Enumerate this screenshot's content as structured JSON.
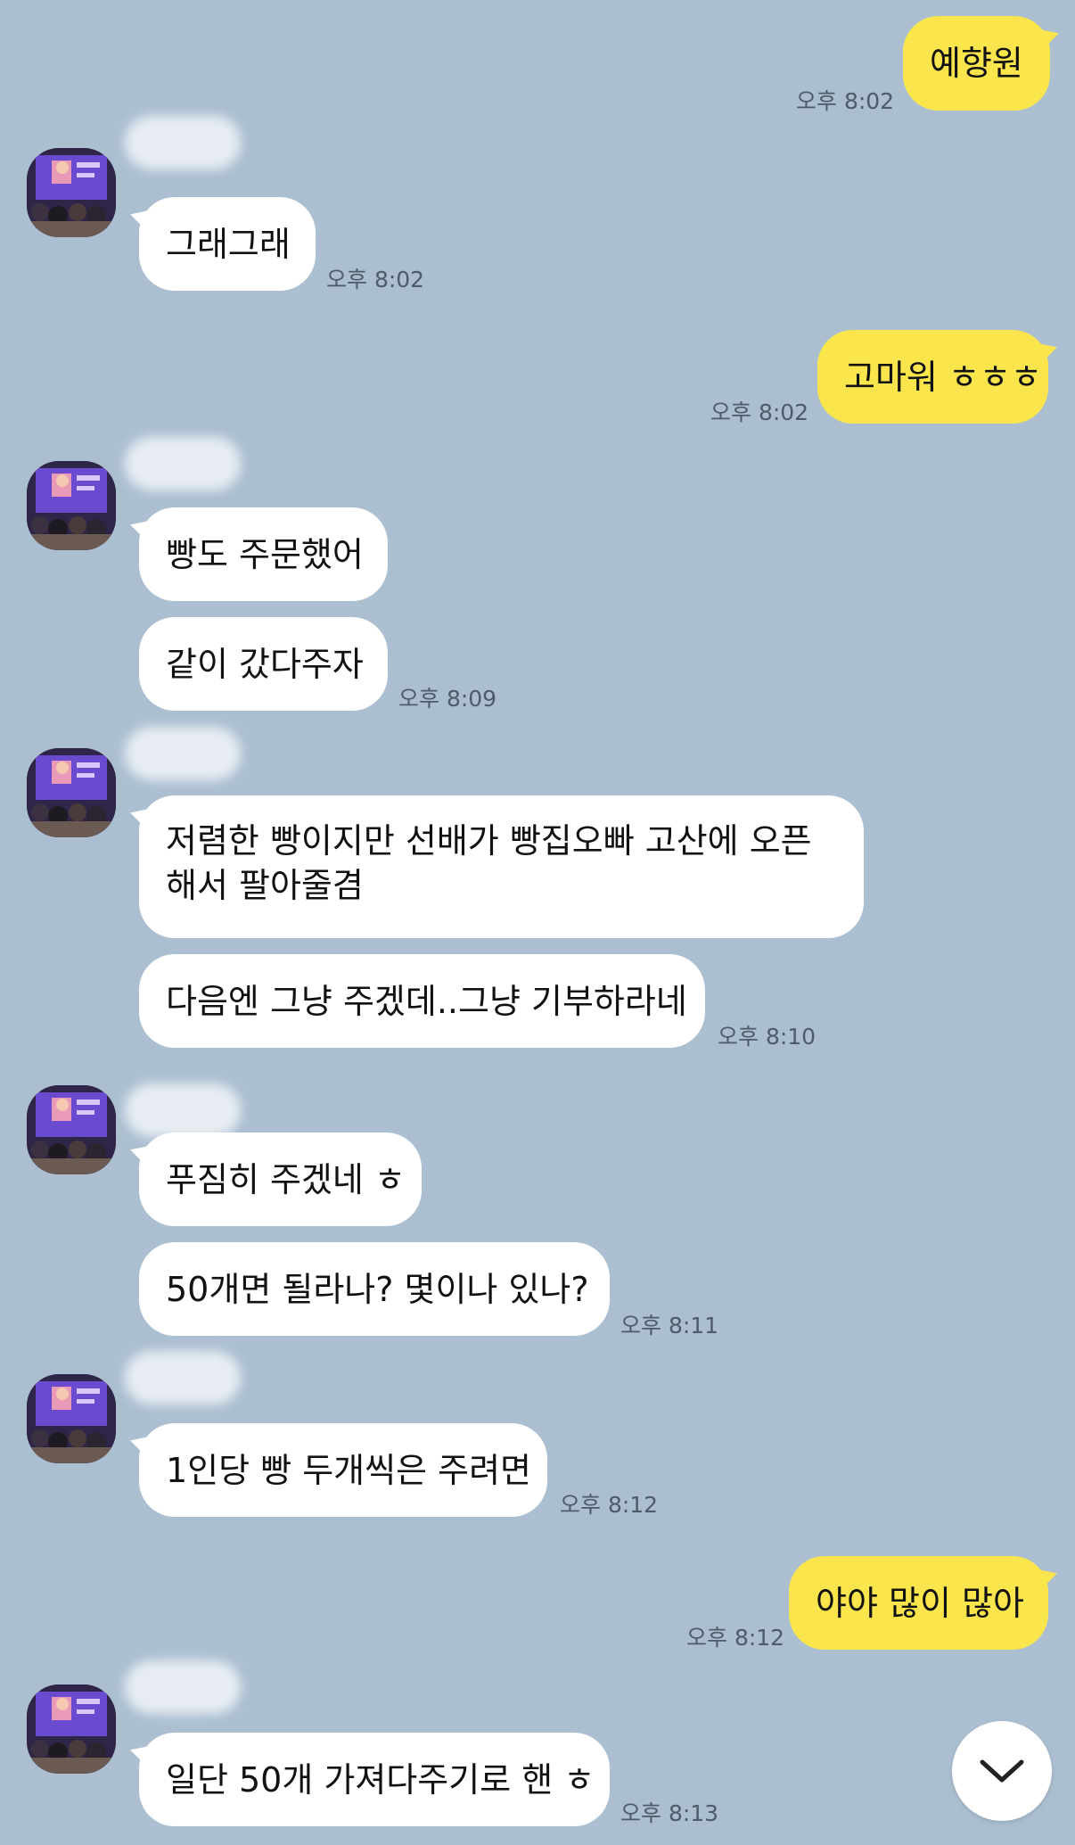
{
  "chat": {
    "messages": [
      {
        "sender": "me",
        "text": "예향원",
        "time": "오후 8:02"
      },
      {
        "sender": "other",
        "text": "그래그래",
        "time": "오후 8:02"
      },
      {
        "sender": "me",
        "text": "고마워 ㅎㅎㅎ",
        "time": "오후 8:02"
      },
      {
        "sender": "other",
        "text": "빵도 주문했어",
        "time": ""
      },
      {
        "sender": "other",
        "text": "같이 갔다주자",
        "time": "오후 8:09"
      },
      {
        "sender": "other",
        "text": "저렴한 빵이지만 선배가 빵집오빠 고산에 오픈해서 팔아줄겸",
        "time": ""
      },
      {
        "sender": "other",
        "text": "다음엔 그냥 주겠데..그냥 기부하라네",
        "time": "오후 8:10"
      },
      {
        "sender": "other",
        "text": "푸짐히 주겠네 ㅎ",
        "time": ""
      },
      {
        "sender": "other",
        "text": "50개면 될라나? 몇이나 있나?",
        "time": "오후 8:11"
      },
      {
        "sender": "other",
        "text": "1인당 빵 두개씩은 주려면",
        "time": "오후 8:12"
      },
      {
        "sender": "me",
        "text": "야야 많이 많아",
        "time": "오후 8:12"
      },
      {
        "sender": "other",
        "text": "일단 50개 가져다주기로 핸 ㅎ",
        "time": "오후 8:13"
      }
    ]
  },
  "icons": {
    "scroll_down": "chevron-down-icon",
    "avatar": "profile-photo"
  },
  "colors": {
    "background": "#abbfd1",
    "my_bubble": "#fae64c",
    "their_bubble": "#ffffff",
    "timestamp": "#4e5b68"
  }
}
